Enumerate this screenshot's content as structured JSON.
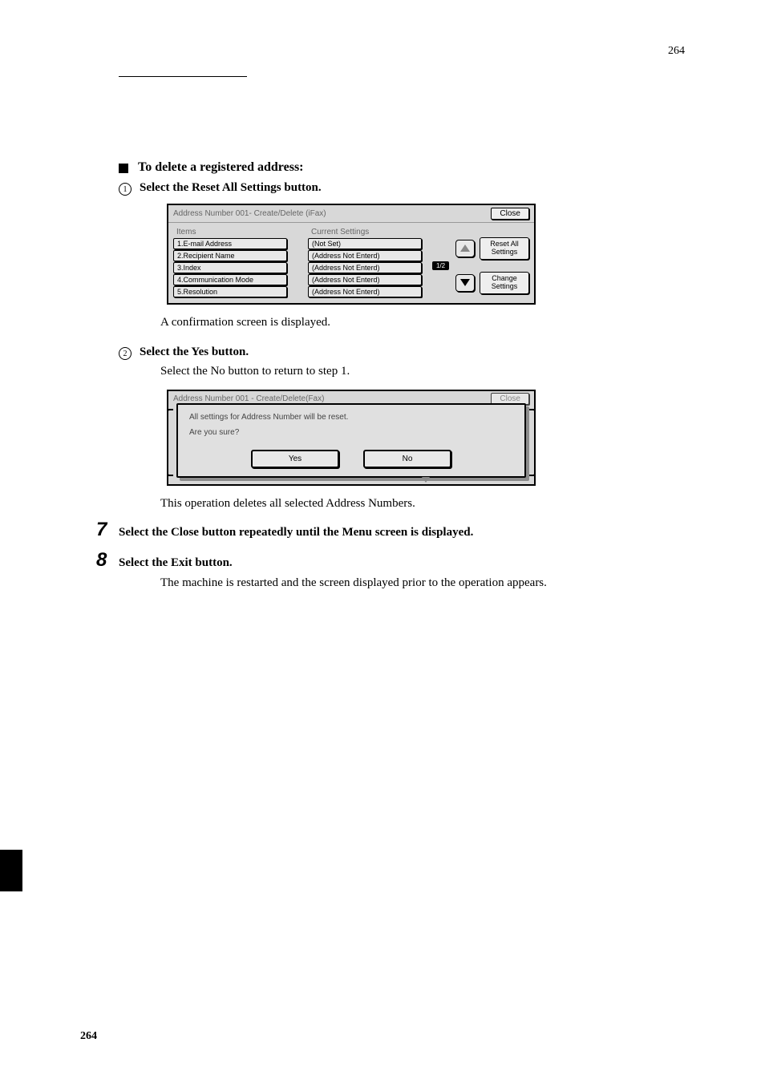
{
  "page_number": "264",
  "section": {
    "heading": "To delete a registered address:",
    "step1": {
      "num": "1",
      "text": "Select the Reset All Settings button."
    },
    "step2": {
      "num": "2",
      "text": "Select the Yes button."
    },
    "confirmation_text": "A confirmation screen is displayed.",
    "return_text": "Select the No button to return to step 1.",
    "deletes_text": "This operation deletes all selected Address Numbers.",
    "big7": {
      "num": "7",
      "text": "Select the Close button repeatedly until the Menu screen is displayed."
    },
    "big8": {
      "num": "8",
      "text": "Select the Exit button."
    },
    "restart_text": "The machine is restarted and the screen displayed prior to the operation appears."
  },
  "dialog1": {
    "title": "Address Number 001- Create/Delete (iFax)",
    "close": "Close",
    "items_header": "Items",
    "settings_header": "Current Settings",
    "rows": [
      {
        "item": "1.E-mail Address",
        "setting": "(Not Set)"
      },
      {
        "item": "2.Recipient Name",
        "setting": "(Address Not Enterd)"
      },
      {
        "item": "3.Index",
        "setting": "(Address Not Enterd)"
      },
      {
        "item": "4.Communication Mode",
        "setting": "(Address Not Enterd)"
      },
      {
        "item": "5.Resolution",
        "setting": "(Address Not Enterd)"
      }
    ],
    "page_indicator": "1/2",
    "reset_all": "Reset All\nSettings",
    "change_settings": "Change\nSettings"
  },
  "dialog2": {
    "title": "Address Number 001 - Create/Delete(Fax)",
    "close": "Close",
    "line1": "All settings for Address Number will be reset.",
    "line2": "Are you sure?",
    "yes": "Yes",
    "no": "No"
  },
  "footer": "264"
}
